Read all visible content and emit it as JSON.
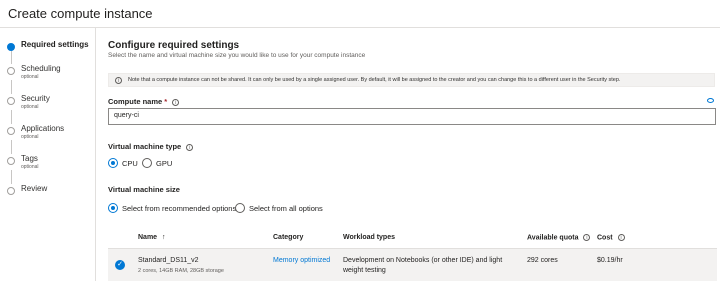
{
  "window": {
    "title": "Create compute instance"
  },
  "steps": [
    {
      "label": "Required settings",
      "sub": "",
      "active": true
    },
    {
      "label": "Scheduling",
      "sub": "optional",
      "active": false
    },
    {
      "label": "Security",
      "sub": "optional",
      "active": false
    },
    {
      "label": "Applications",
      "sub": "optional",
      "active": false
    },
    {
      "label": "Tags",
      "sub": "optional",
      "active": false
    },
    {
      "label": "Review",
      "sub": "",
      "active": false
    }
  ],
  "section": {
    "title": "Configure required settings",
    "subtitle": "Select the name and virtual machine size you would like to use for your compute instance"
  },
  "note": {
    "text": "Note that a compute instance can not be shared. It can only be used by a single assigned user. By default, it will be assigned to the creator and you can change this to a different user in the Security step.",
    "icon": "info-icon"
  },
  "compute_name": {
    "label": "Compute name",
    "required_mark": "*",
    "value": "query-ci"
  },
  "vm_type": {
    "label": "Virtual machine type",
    "options": [
      {
        "label": "CPU",
        "selected": true
      },
      {
        "label": "GPU",
        "selected": false
      }
    ]
  },
  "vm_size": {
    "label": "Virtual machine size",
    "options": [
      {
        "label": "Select from recommended options",
        "selected": true
      },
      {
        "label": "Select from all options",
        "selected": false
      }
    ]
  },
  "table": {
    "columns": [
      "Name",
      "Category",
      "Workload types",
      "Available quota",
      "Cost"
    ],
    "sort_icon": "↑",
    "rows": [
      {
        "name": "Standard_DS11_v2",
        "spec": "2 cores, 14GB RAM, 28GB storage",
        "category": "Memory optimized",
        "workload_1": "Development on Notebooks (or other IDE) and light",
        "workload_2": "weight testing",
        "quota": "292 cores",
        "cost": "$0.19/hr",
        "selected": true
      }
    ]
  },
  "colors": {
    "accent": "#0078d4",
    "border": "#e1dfdd",
    "note_bg": "#f3f2f1"
  }
}
